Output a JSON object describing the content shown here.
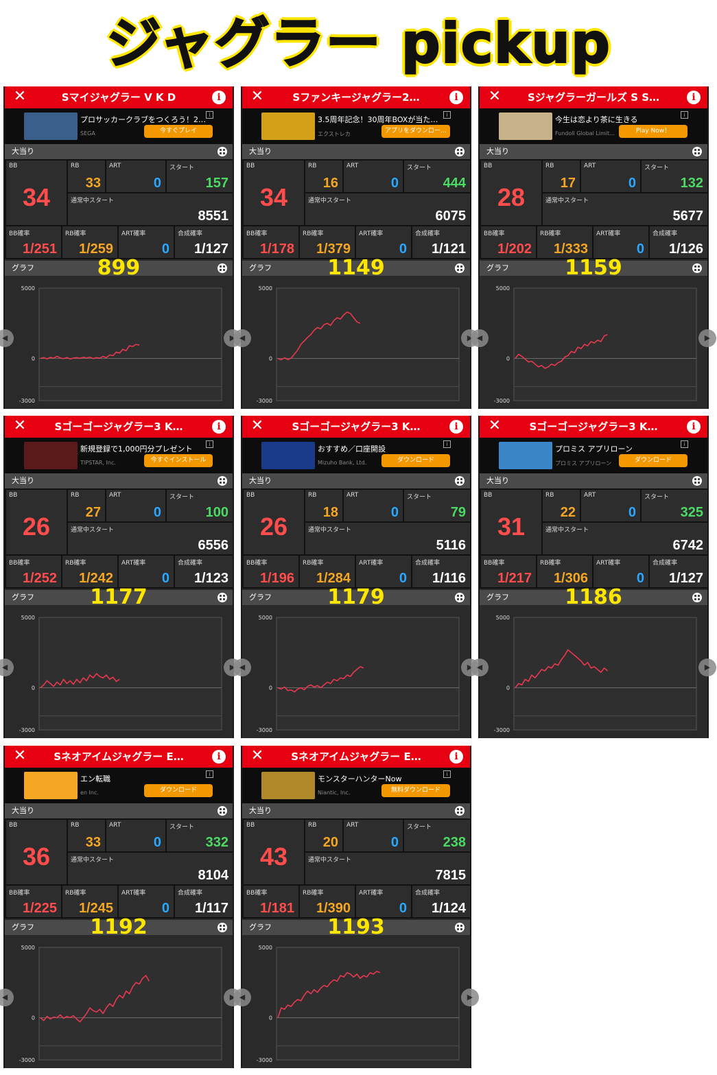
{
  "title": "ジャグラー pickup",
  "labels": {
    "close": "✕",
    "info": "i",
    "hit_section": "大当り",
    "graph_section": "グラフ",
    "bb": "BB",
    "rb": "RB",
    "art": "ART",
    "start": "スタート",
    "normal_start": "通常中スタート",
    "bb_rate": "BB確率",
    "rb_rate": "RB確率",
    "art_rate": "ART確率",
    "total_rate": "合成確率",
    "y_top": "5000",
    "y_zero": "0",
    "y_bottom": "-3000"
  },
  "colors": {
    "header_red": "#e60012",
    "accent_yellow": "#ffe600",
    "bb_red": "#ff4c4c",
    "rb_orange": "#f5a623",
    "art_blue": "#29a8ff",
    "start_green": "#4cd964",
    "graph_line": "#e8384f",
    "ad_button": "#f39800"
  },
  "panels": [
    {
      "machine": "Sマイジャグラー V K D",
      "ad": {
        "title": "プロサッカークラブをつくろう！2…",
        "sub": "SEGA",
        "button": "今すぐプレイ",
        "thumb": "#3a5f8a"
      },
      "bb": "34",
      "rb": "33",
      "art": "0",
      "start": "157",
      "normal_start": "8551",
      "bb_rate": "1/251",
      "rb_rate": "1/259",
      "art_rate": "0",
      "total_rate": "1/127",
      "graph_no": "899",
      "series": [
        0,
        60,
        -30,
        80,
        20,
        150,
        40,
        -20,
        70,
        -40,
        30,
        60,
        10,
        90,
        30,
        100,
        -10,
        60,
        20,
        150,
        50,
        250,
        200,
        450,
        380,
        650,
        550,
        900,
        850,
        1000,
        950
      ]
    },
    {
      "machine": "Sファンキージャグラー2…",
      "ad": {
        "title": "3.5周年記念！30周年BOXが当た…",
        "sub": "エクストレカ",
        "button": "アプリをダウンロー…",
        "thumb": "#d4a017"
      },
      "bb": "34",
      "rb": "16",
      "art": "0",
      "start": "444",
      "normal_start": "6075",
      "bb_rate": "1/178",
      "rb_rate": "1/379",
      "art_rate": "0",
      "total_rate": "1/121",
      "graph_no": "1149",
      "series": [
        0,
        -100,
        50,
        -80,
        20,
        300,
        600,
        1000,
        1250,
        1500,
        1700,
        2000,
        2200,
        2100,
        2400,
        2500,
        2350,
        2700,
        2900,
        2800,
        3100,
        3300,
        3200,
        2900,
        2600,
        2500
      ]
    },
    {
      "machine": "Sジャグラーガールズ S S…",
      "ad": {
        "title": "今生は恋より茶に生きる",
        "sub": "Fundoll Global Limit…",
        "button": "Play Now！",
        "thumb": "#c8b28a"
      },
      "bb": "28",
      "rb": "17",
      "art": "0",
      "start": "132",
      "normal_start": "5677",
      "bb_rate": "1/202",
      "rb_rate": "1/333",
      "art_rate": "0",
      "total_rate": "1/126",
      "graph_no": "1159",
      "series": [
        0,
        300,
        150,
        -50,
        -250,
        -200,
        -400,
        -600,
        -500,
        -700,
        -600,
        -400,
        -500,
        -300,
        -200,
        100,
        200,
        500,
        400,
        800,
        700,
        1000,
        900,
        1200,
        1100,
        1300,
        1200,
        1600,
        1700
      ]
    },
    {
      "machine": "Sゴーゴージャグラー3 K…",
      "ad": {
        "title": "新規登録で1,000円分プレゼント",
        "sub": "TIPSTAR, Inc.",
        "button": "今すぐインストール",
        "thumb": "#5a1a1a"
      },
      "bb": "26",
      "rb": "27",
      "art": "0",
      "start": "100",
      "normal_start": "6556",
      "bb_rate": "1/252",
      "rb_rate": "1/242",
      "art_rate": "0",
      "total_rate": "1/123",
      "graph_no": "1177",
      "series": [
        0,
        200,
        500,
        300,
        100,
        400,
        200,
        600,
        300,
        500,
        250,
        600,
        350,
        700,
        500,
        900,
        700,
        1000,
        800,
        700,
        900,
        600,
        750,
        450,
        600
      ]
    },
    {
      "machine": "Sゴーゴージャグラー3 K…",
      "ad": {
        "title": "おすすめ／口座開設",
        "sub": "Mizuho Bank, Ltd.",
        "button": "ダウンロード",
        "thumb": "#1a3a8a"
      },
      "bb": "26",
      "rb": "18",
      "art": "0",
      "start": "79",
      "normal_start": "5116",
      "bb_rate": "1/196",
      "rb_rate": "1/284",
      "art_rate": "0",
      "total_rate": "1/116",
      "graph_no": "1179",
      "series": [
        0,
        -100,
        50,
        -200,
        -150,
        -300,
        -100,
        0,
        -150,
        100,
        200,
        50,
        150,
        0,
        200,
        400,
        300,
        600,
        500,
        700,
        650,
        900,
        800,
        1100,
        1300,
        1500,
        1400
      ]
    },
    {
      "machine": "Sゴーゴージャグラー3 K…",
      "ad": {
        "title": "プロミス アプリローン",
        "sub": "プロミス アプリローン",
        "button": "ダウンロード",
        "thumb": "#3b86c9"
      },
      "bb": "31",
      "rb": "22",
      "art": "0",
      "start": "325",
      "normal_start": "6742",
      "bb_rate": "1/217",
      "rb_rate": "1/306",
      "art_rate": "0",
      "total_rate": "1/127",
      "graph_no": "1186",
      "series": [
        0,
        300,
        200,
        600,
        450,
        900,
        700,
        1000,
        1300,
        1200,
        1500,
        1400,
        1700,
        1600,
        2000,
        2300,
        2700,
        2500,
        2300,
        2100,
        1900,
        1600,
        1800,
        1400,
        1500,
        1300,
        1100,
        1400,
        1200
      ]
    },
    {
      "machine": "Sネオアイムジャグラー E…",
      "ad": {
        "title": "エン転職",
        "sub": "en Inc.",
        "button": "ダウンロード",
        "thumb": "#f5a623"
      },
      "bb": "36",
      "rb": "33",
      "art": "0",
      "start": "332",
      "normal_start": "8104",
      "bb_rate": "1/225",
      "rb_rate": "1/245",
      "art_rate": "0",
      "total_rate": "1/117",
      "graph_no": "1192",
      "series": [
        0,
        -200,
        100,
        -100,
        50,
        0,
        200,
        -50,
        100,
        0,
        150,
        -100,
        -300,
        0,
        300,
        700,
        500,
        400,
        600,
        300,
        700,
        1000,
        800,
        1300,
        1600,
        1400,
        1900,
        1700,
        2200,
        2500,
        2400,
        2800,
        3000,
        2600
      ]
    },
    {
      "machine": "Sネオアイムジャグラー E…",
      "ad": {
        "title": "モンスターハンターNow",
        "sub": "Niantic, Inc.",
        "button": "無料ダウンロード",
        "thumb": "#b08a2a"
      },
      "bb": "43",
      "rb": "20",
      "art": "0",
      "start": "238",
      "normal_start": "7815",
      "bb_rate": "1/181",
      "rb_rate": "1/390",
      "art_rate": "0",
      "total_rate": "1/124",
      "graph_no": "1193",
      "series": [
        0,
        700,
        600,
        900,
        800,
        1100,
        1300,
        1200,
        1600,
        1900,
        1700,
        2000,
        1800,
        2100,
        2300,
        2200,
        2500,
        2700,
        2600,
        3000,
        2900,
        3200,
        3100,
        2900,
        3100,
        2800,
        3000,
        2900,
        3200,
        3100,
        3300,
        3200
      ]
    }
  ]
}
